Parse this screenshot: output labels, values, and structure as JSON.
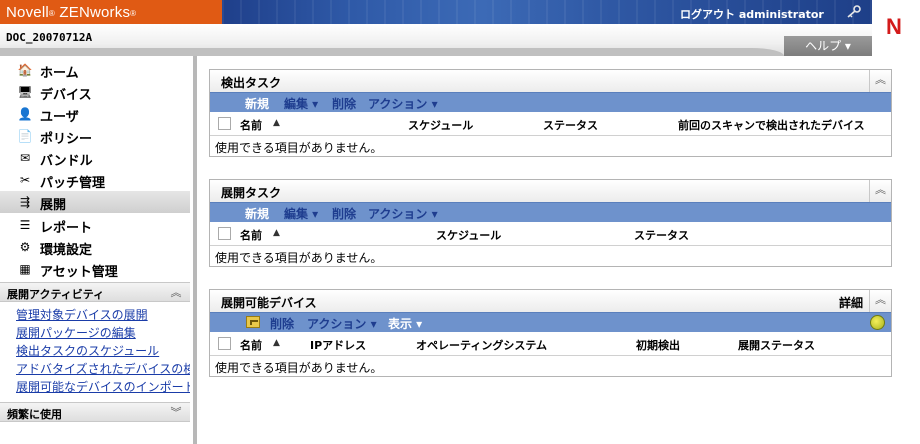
{
  "header": {
    "brand": "Novell",
    "brand_mark": "®",
    "product": "ZENworks",
    "product_mark": "®",
    "logout_label": "ログアウト administrator",
    "zone_name": "DOC_20070712A",
    "help_label": "ヘルプ ▾",
    "corner_logo": "N"
  },
  "nav": {
    "items": [
      {
        "label": "ホーム",
        "icon": "home-icon",
        "glyph": "🏠"
      },
      {
        "label": "デバイス",
        "icon": "monitor-icon",
        "glyph": "🖥"
      },
      {
        "label": "ユーザ",
        "icon": "user-icon",
        "glyph": "👤"
      },
      {
        "label": "ポリシー",
        "icon": "policy-icon",
        "glyph": "📄"
      },
      {
        "label": "バンドル",
        "icon": "bundle-icon",
        "glyph": "✉"
      },
      {
        "label": "パッチ管理",
        "icon": "patch-icon",
        "glyph": "✂"
      },
      {
        "label": "展開",
        "icon": "deploy-icon",
        "glyph": "⇶"
      },
      {
        "label": "レポート",
        "icon": "report-icon",
        "glyph": "☰"
      },
      {
        "label": "環境設定",
        "icon": "settings-icon",
        "glyph": "⚙"
      },
      {
        "label": "アセット管理",
        "icon": "asset-icon",
        "glyph": "▦"
      }
    ],
    "selected_index": 6
  },
  "activities": {
    "title": "展開アクティビティ",
    "links": [
      "管理対象デバイスの展開",
      "展開パッケージの編集",
      "検出タスクのスケジュール",
      "アドバタイズされたデバイスの検",
      "展開可能なデバイスのインポート"
    ]
  },
  "frequent": {
    "title": "頻繁に使用"
  },
  "panels": {
    "discovery": {
      "title": "検出タスク",
      "toolbar": {
        "new": "新規",
        "edit": "編集 ▾",
        "delete": "削除",
        "action": "アクション ▾"
      },
      "columns": {
        "name": "名前",
        "schedule": "スケジュール",
        "status": "ステータス",
        "last_scan": "前回のスキャンで検出されたデバイス"
      },
      "sort_glyph": "▲",
      "empty": "使用できる項目がありません。"
    },
    "deployment": {
      "title": "展開タスク",
      "toolbar": {
        "new": "新規",
        "edit": "編集 ▾",
        "delete": "削除",
        "action": "アクション ▾"
      },
      "columns": {
        "name": "名前",
        "schedule": "スケジュール",
        "status": "ステータス"
      },
      "sort_glyph": "▲",
      "empty": "使用できる項目がありません。"
    },
    "deployable": {
      "title": "展開可能デバイス",
      "details": "詳細",
      "toolbar": {
        "delete": "削除",
        "action": "アクション ▾",
        "view": "表示 ▾"
      },
      "columns": {
        "name": "名前",
        "ip": "IPアドレス",
        "os": "オペレーティングシステム",
        "first_found": "初期検出",
        "deploy_status": "展開ステータス"
      },
      "sort_glyph": "▲",
      "empty": "使用できる項目がありません。"
    }
  },
  "colors": {
    "brand_orange": "#e05a14",
    "toolbar_blue": "#6e92cc",
    "link_blue": "#1a3ca8",
    "novell_red": "#d31b1b"
  }
}
